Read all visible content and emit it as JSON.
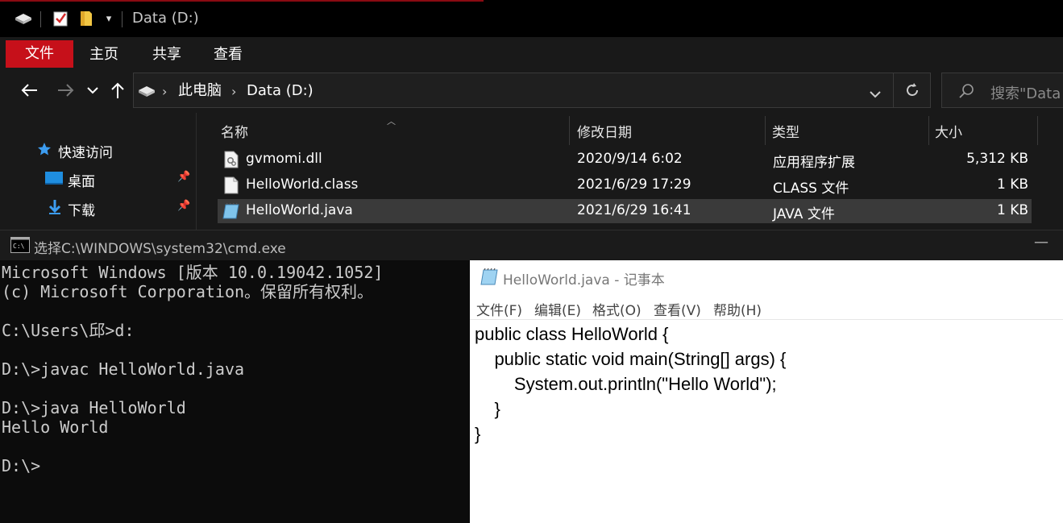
{
  "explorer": {
    "title": "Data (D:)",
    "ribbon_tabs": [
      "文件",
      "主页",
      "共享",
      "查看"
    ],
    "address": {
      "crumbs": [
        "此电脑",
        "Data (D:)"
      ]
    },
    "search_placeholder": "搜索\"Data",
    "nav_pane": [
      {
        "label": "快速访问",
        "icon": "star-icon"
      },
      {
        "label": "桌面",
        "icon": "desktop-icon",
        "pinned": true
      },
      {
        "label": "下载",
        "icon": "download-icon",
        "pinned": true
      }
    ],
    "columns": [
      "名称",
      "修改日期",
      "类型",
      "大小"
    ],
    "files": [
      {
        "name": "gvmomi.dll",
        "date": "2020/9/14 6:02",
        "type": "应用程序扩展",
        "size": "5,312 KB",
        "icon": "dll-file-icon",
        "selected": false
      },
      {
        "name": "HelloWorld.class",
        "date": "2021/6/29 17:29",
        "type": "CLASS 文件",
        "size": "1 KB",
        "icon": "blank-file-icon",
        "selected": false
      },
      {
        "name": "HelloWorld.java",
        "date": "2021/6/29 16:41",
        "type": "JAVA 文件",
        "size": "1 KB",
        "icon": "notepad-file-icon",
        "selected": true
      }
    ]
  },
  "cmd": {
    "title": "选择C:\\WINDOWS\\system32\\cmd.exe",
    "output": "Microsoft Windows [版本 10.0.19042.1052]\n(c) Microsoft Corporation。保留所有权利。\n\nC:\\Users\\邱>d:\n\nD:\\>javac HelloWorld.java\n\nD:\\>java HelloWorld\nHello World\n\nD:\\>"
  },
  "notepad": {
    "title": "HelloWorld.java - 记事本",
    "menu": [
      "文件(F)",
      "编辑(E)",
      "格式(O)",
      "查看(V)",
      "帮助(H)"
    ],
    "content": "public class HelloWorld {\n    public static void main(String[] args) {\n        System.out.println(\"Hello World\");\n    }\n}"
  }
}
